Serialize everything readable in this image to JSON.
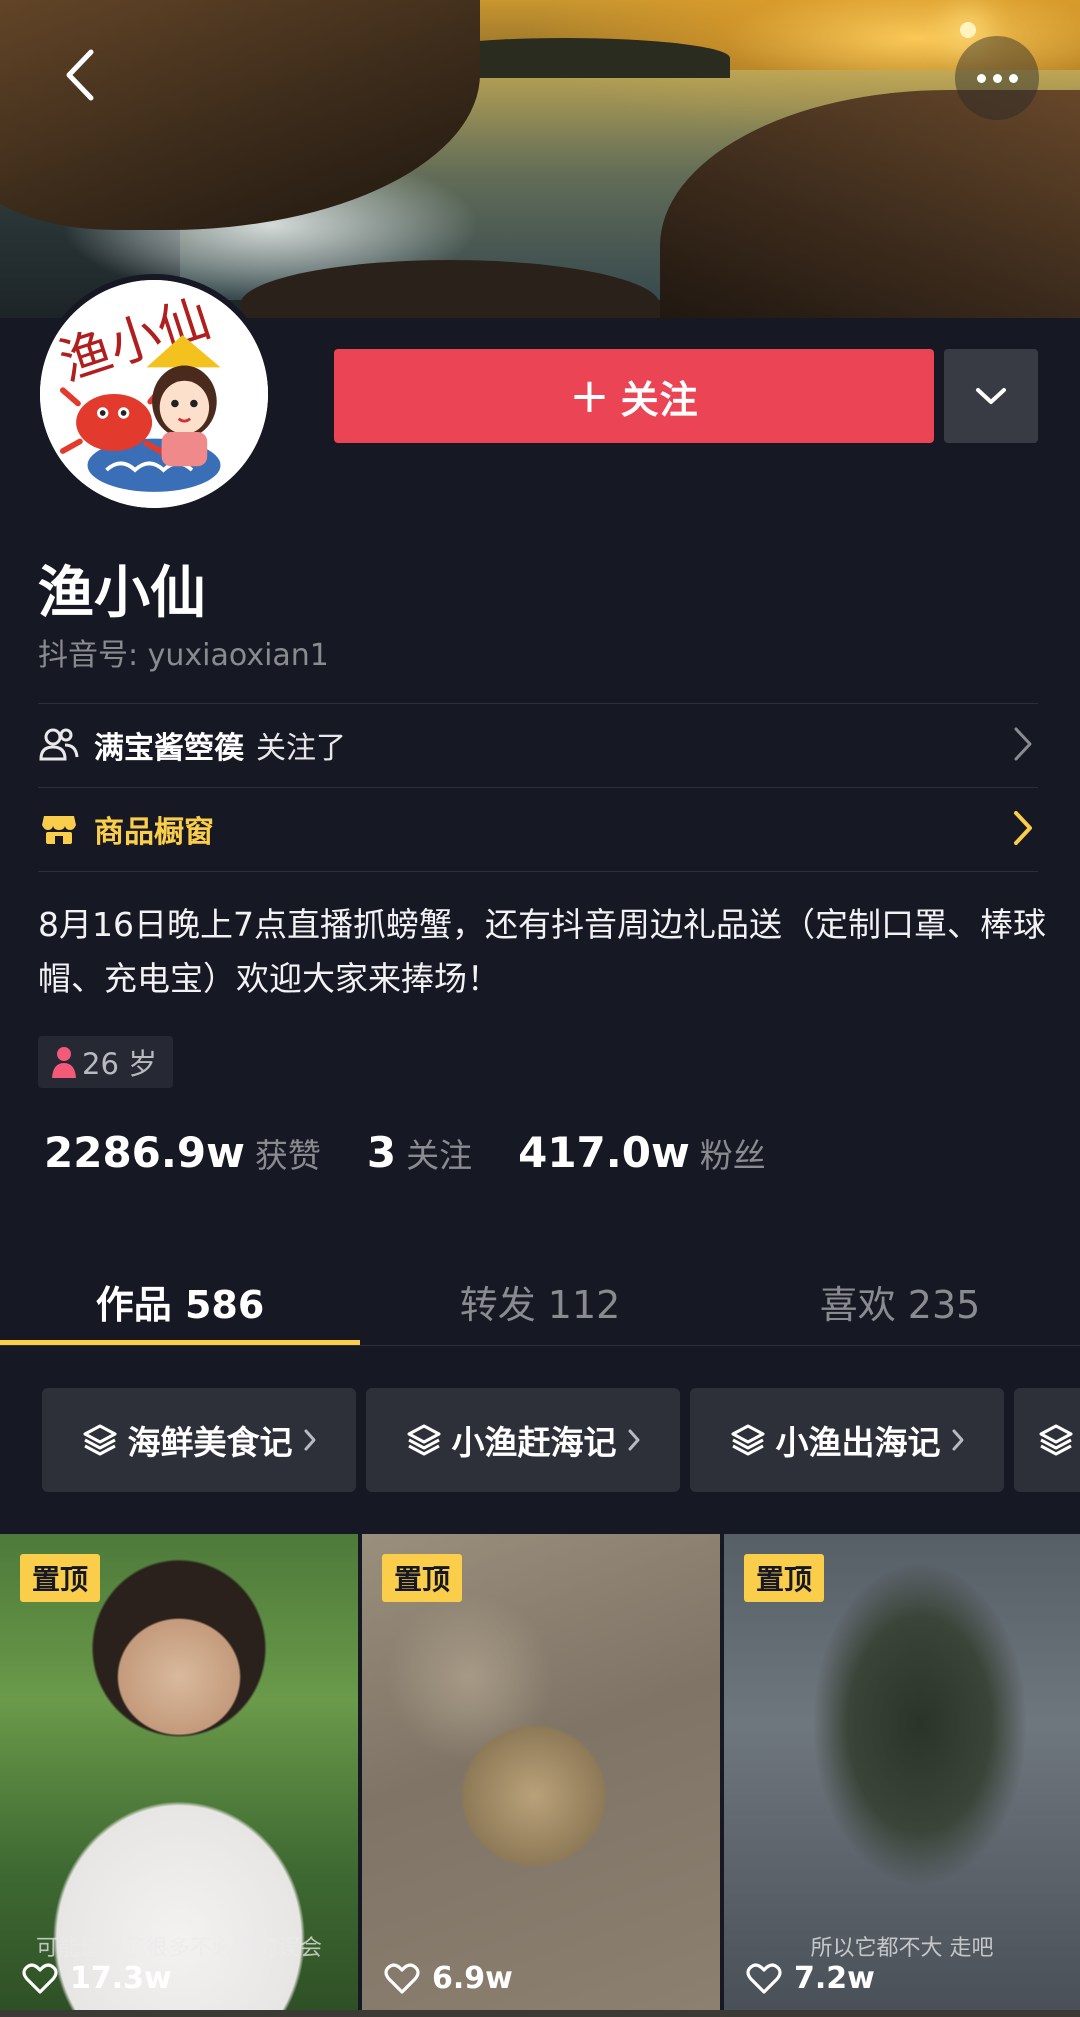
{
  "header": {
    "back_icon": "chevron-left-icon",
    "more_icon": "ellipsis-icon"
  },
  "profile": {
    "avatar_text": "渔小仙",
    "follow_button_label": "关注",
    "follow_plus": "+",
    "name": "渔小仙",
    "douyin_id": "抖音号: yuxiaoxian1"
  },
  "mutual": {
    "name": "满宝酱箜篌",
    "suffix": "关注了"
  },
  "shop": {
    "label": "商品橱窗"
  },
  "bio": "8月16日晚上7点直播抓螃蟹，还有抖音周边礼品送（定制口罩、棒球帽、充电宝）欢迎大家来捧场！",
  "age_tag": "26 岁",
  "stats": {
    "likes_value": "2286.9w",
    "likes_label": "获赞",
    "following_value": "3",
    "following_label": "关注",
    "fans_value": "417.0w",
    "fans_label": "粉丝"
  },
  "tabs": [
    {
      "label": "作品 586"
    },
    {
      "label": "转发 112"
    },
    {
      "label": "喜欢 235"
    }
  ],
  "collections": [
    {
      "label": "海鲜美食记"
    },
    {
      "label": "小渔赶海记"
    },
    {
      "label": "小渔出海记"
    }
  ],
  "videos": [
    {
      "pinned": "置顶",
      "likes": "17.3w",
      "subtitle": "可能造成了很多不必要的误会"
    },
    {
      "pinned": "置顶",
      "likes": "6.9w",
      "subtitle": ""
    },
    {
      "pinned": "置顶",
      "likes": "7.2w",
      "subtitle": "所以它都不大 走吧"
    }
  ],
  "colors": {
    "background": "#161823",
    "follow_red": "#ea4455",
    "accent_yellow": "#facd4a"
  }
}
